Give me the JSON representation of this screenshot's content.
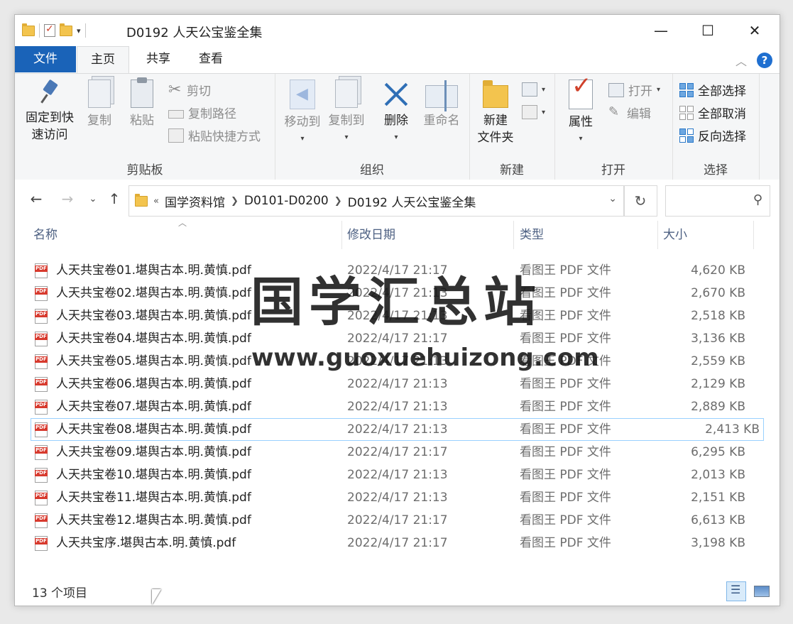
{
  "window": {
    "title": "D0192 人天公宝鉴全集",
    "qat_dropdown": "▾",
    "caption": {
      "minimize": "—",
      "maximize": "☐",
      "close": "✕"
    }
  },
  "tabs": [
    {
      "label": "文件"
    },
    {
      "label": "主页"
    },
    {
      "label": "共享"
    },
    {
      "label": "查看"
    }
  ],
  "ribbon": {
    "clipboard": {
      "label": "剪贴板",
      "pin_line1": "固定到快",
      "pin_line2": "速访问",
      "copy": "复制",
      "paste": "粘贴",
      "cut": "剪切",
      "copy_path": "复制路径",
      "paste_shortcut": "粘贴快捷方式"
    },
    "organize": {
      "label": "组织",
      "move_to": "移动到",
      "copy_to": "复制到",
      "delete": "删除",
      "rename": "重命名"
    },
    "new": {
      "label": "新建",
      "new_folder_line1": "新建",
      "new_folder_line2": "文件夹"
    },
    "open": {
      "label": "打开",
      "properties": "属性",
      "open": "打开",
      "edit": "编辑"
    },
    "select": {
      "label": "选择",
      "select_all": "全部选择",
      "select_none": "全部取消",
      "invert": "反向选择"
    }
  },
  "address": {
    "overflow": "«",
    "crumbs": [
      "国学资料馆",
      "D0101-D0200",
      "D0192 人天公宝鉴全集"
    ]
  },
  "columns": {
    "name": "名称",
    "date": "修改日期",
    "type": "类型",
    "size": "大小"
  },
  "files": [
    {
      "name": "人天共宝卷01.堪舆古本.明.黄慎.pdf",
      "date": "2022/4/17 21:17",
      "type": "看图王 PDF 文件",
      "size": "4,620 KB"
    },
    {
      "name": "人天共宝卷02.堪舆古本.明.黄慎.pdf",
      "date": "2022/4/17 21:13",
      "type": "看图王 PDF 文件",
      "size": "2,670 KB"
    },
    {
      "name": "人天共宝卷03.堪舆古本.明.黄慎.pdf",
      "date": "2022/4/17 21:13",
      "type": "看图王 PDF 文件",
      "size": "2,518 KB"
    },
    {
      "name": "人天共宝卷04.堪舆古本.明.黄慎.pdf",
      "date": "2022/4/17 21:17",
      "type": "看图王 PDF 文件",
      "size": "3,136 KB"
    },
    {
      "name": "人天共宝卷05.堪舆古本.明.黄慎.pdf",
      "date": "2022/4/17 21:13",
      "type": "看图王 PDF 文件",
      "size": "2,559 KB"
    },
    {
      "name": "人天共宝卷06.堪舆古本.明.黄慎.pdf",
      "date": "2022/4/17 21:13",
      "type": "看图王 PDF 文件",
      "size": "2,129 KB"
    },
    {
      "name": "人天共宝卷07.堪舆古本.明.黄慎.pdf",
      "date": "2022/4/17 21:13",
      "type": "看图王 PDF 文件",
      "size": "2,889 KB"
    },
    {
      "name": "人天共宝卷08.堪舆古本.明.黄慎.pdf",
      "date": "2022/4/17 21:13",
      "type": "看图王 PDF 文件",
      "size": "2,413 KB"
    },
    {
      "name": "人天共宝卷09.堪舆古本.明.黄慎.pdf",
      "date": "2022/4/17 21:17",
      "type": "看图王 PDF 文件",
      "size": "6,295 KB"
    },
    {
      "name": "人天共宝卷10.堪舆古本.明.黄慎.pdf",
      "date": "2022/4/17 21:13",
      "type": "看图王 PDF 文件",
      "size": "2,013 KB"
    },
    {
      "name": "人天共宝卷11.堪舆古本.明.黄慎.pdf",
      "date": "2022/4/17 21:13",
      "type": "看图王 PDF 文件",
      "size": "2,151 KB"
    },
    {
      "name": "人天共宝卷12.堪舆古本.明.黄慎.pdf",
      "date": "2022/4/17 21:17",
      "type": "看图王 PDF 文件",
      "size": "6,613 KB"
    },
    {
      "name": "人天共宝序.堪舆古本.明.黄慎.pdf",
      "date": "2022/4/17 21:17",
      "type": "看图王 PDF 文件",
      "size": "3,198 KB"
    }
  ],
  "selected_index": 7,
  "watermark": {
    "text": "国学汇总站",
    "url": "www.guoxuehuizong.com"
  },
  "status": {
    "item_count": "13 个项目"
  },
  "colors": {
    "accent": "#1a63b8",
    "header_text": "#4d6082",
    "selection_border": "#99d1ff"
  },
  "icons": {
    "folder": "folder-icon",
    "pdf": "pdf-file-icon",
    "help": "help-icon",
    "refresh": "refresh-icon",
    "search": "search-icon"
  }
}
